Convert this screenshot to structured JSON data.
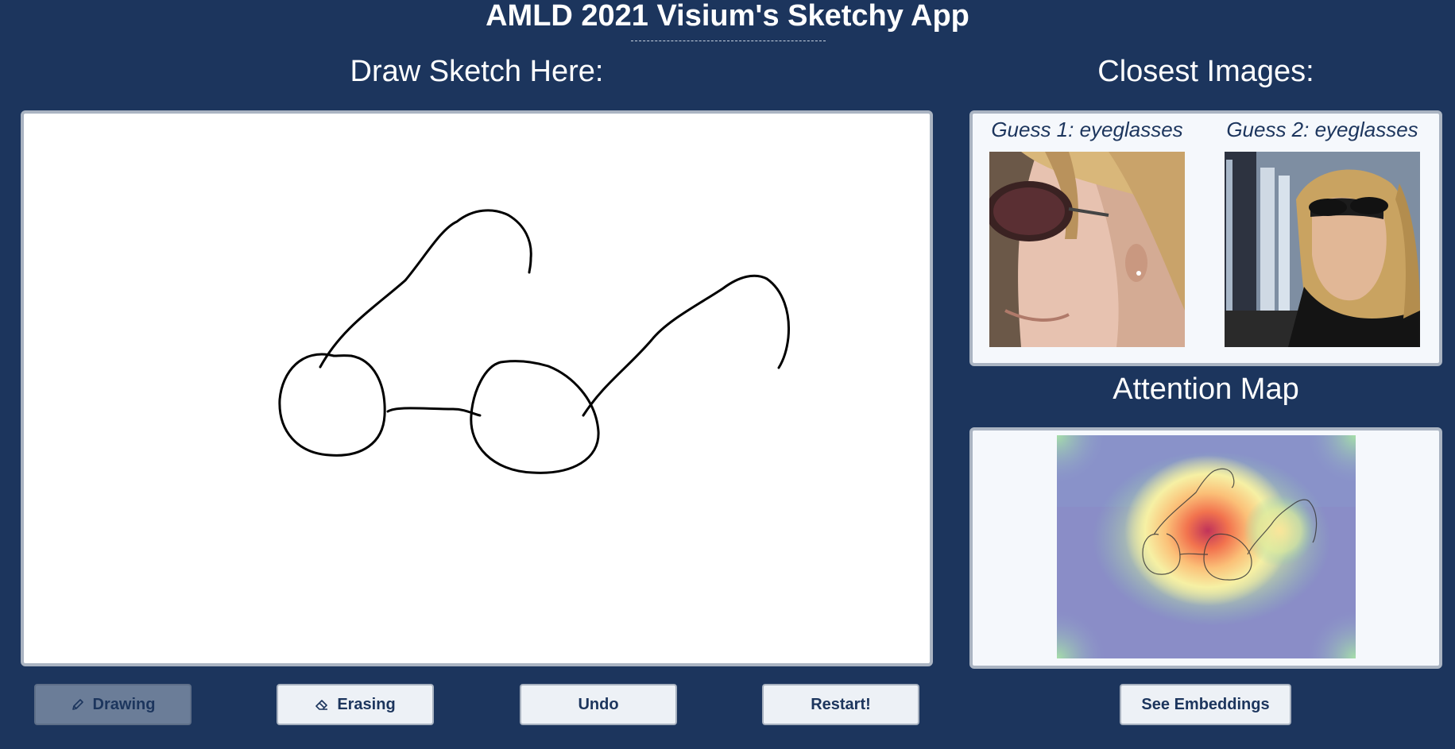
{
  "app": {
    "title": "AMLD 2021 Visium's Sketchy App"
  },
  "sections": {
    "draw_heading": "Draw Sketch Here:",
    "closest_heading": "Closest Images:",
    "attention_heading": "Attention Map"
  },
  "guesses": [
    {
      "caption": "Guess 1: eyeglasses",
      "image": "photo-woman-sunglasses-profile"
    },
    {
      "caption": "Guess 2: eyeglasses",
      "image": "photo-woman-sunglasses-window"
    }
  ],
  "toolbar": {
    "drawing_label": "Drawing",
    "erasing_label": "Erasing",
    "undo_label": "Undo",
    "restart_label": "Restart!",
    "embeddings_label": "See Embeddings",
    "active_mode": "Drawing"
  },
  "icons": {
    "drawing": "pencil-icon",
    "erasing": "eraser-icon"
  },
  "colors": {
    "background": "#1c355d",
    "panel": "#f5f8fc",
    "button": "#edf1f6",
    "button_active": "#6b7d98",
    "stroke": "#000000"
  }
}
